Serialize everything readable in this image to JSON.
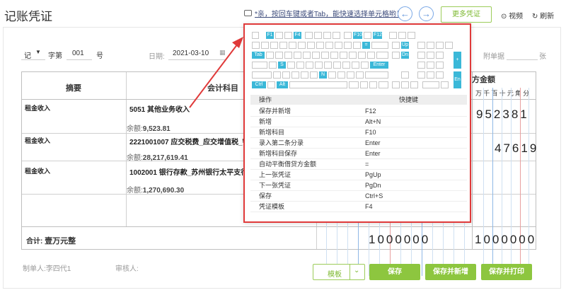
{
  "header": {
    "title": "记账凭证",
    "hint": "*亲，按回车键或者Tab，能快速选择单元格哟！*",
    "prev_icon": "arrow-left-icon",
    "next_icon": "arrow-right-icon",
    "more_vouchers": "更多凭证",
    "video": "视频",
    "refresh": "刷新"
  },
  "voucher_meta": {
    "word_type": "记",
    "word_label": "字第",
    "number": "001",
    "number_suffix": "号",
    "date_label": "日期:",
    "date_value": "2021-03-10",
    "attachments_label": "附单据",
    "attachments_unit": "张"
  },
  "table": {
    "col_summary": "摘要",
    "col_account": "会计科目",
    "col_credit": "方金额",
    "digit_units": [
      "千",
      "万",
      "千",
      "百",
      "十",
      "元",
      "角",
      "分"
    ],
    "rows": [
      {
        "summary": "租金收入",
        "account": "5051 其他业务收入",
        "balance_label": "余额:",
        "balance": "9,523.81",
        "credit": "952381"
      },
      {
        "summary": "租金收入",
        "account": "2221001007 应交税费_应交增值税_销项",
        "balance_label": "余额:",
        "balance": "28,217,619.41",
        "credit": "47619"
      },
      {
        "summary": "租金收入",
        "account": "1002001 银行存款_苏州银行太平支行",
        "balance_label": "余额:",
        "balance": "1,270,690.30",
        "credit": ""
      }
    ],
    "total_label": "合计:",
    "total_text": "壹万元整",
    "total_debit": "1000000",
    "total_credit": "1000000"
  },
  "footer": {
    "maker_label": "制单人:",
    "maker": "李四代1",
    "auditor_label": "审核人:",
    "template": "模板",
    "save": "保存",
    "save_new": "保存并新增",
    "save_print": "保存并打印"
  },
  "popup": {
    "keys": {
      "f1": "F1",
      "f4": "F4",
      "f10": "F10",
      "f12": "F12",
      "eq": "=",
      "up": "Up",
      "dn": "Dn",
      "tab": "Tab",
      "s": "S",
      "enter": "Enter",
      "n": "N",
      "ctrl": "Ctrl",
      "alt": "Alt",
      "plus": "+",
      "en": "En"
    },
    "col_action": "操作",
    "col_shortcut": "快捷键",
    "shortcuts": [
      {
        "action": "保存并新增",
        "key": "F12"
      },
      {
        "action": "新增",
        "key": "Alt+N"
      },
      {
        "action": "新增科目",
        "key": "F10"
      },
      {
        "action": "录入第二条分录",
        "key": "Enter"
      },
      {
        "action": "新增科目保存",
        "key": "Enter"
      },
      {
        "action": "自动平衡借贷方金额",
        "key": "="
      },
      {
        "action": "上一张凭证",
        "key": "PgUp"
      },
      {
        "action": "下一张凭证",
        "key": "PgDn"
      },
      {
        "action": "保存",
        "key": "Ctrl+S"
      },
      {
        "action": "凭证模板",
        "key": "F4"
      }
    ]
  },
  "colors": {
    "accent_green": "#8dc63f",
    "highlight_red": "#e03a3a",
    "key_blue": "#3bb8d8"
  }
}
